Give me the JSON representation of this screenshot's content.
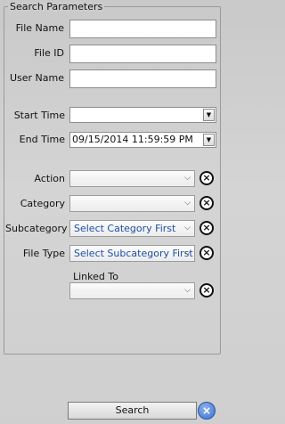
{
  "panel": {
    "title": "Search Parameters"
  },
  "fields": {
    "file_name": {
      "label": "File Name",
      "value": ""
    },
    "file_id": {
      "label": "File ID",
      "value": ""
    },
    "user_name": {
      "label": "User Name",
      "value": ""
    },
    "start_time": {
      "label": "Start Time",
      "value": ""
    },
    "end_time": {
      "label": "End Time",
      "value": "09/15/2014 11:59:59 PM"
    },
    "action": {
      "label": "Action",
      "value": ""
    },
    "category": {
      "label": "Category",
      "value": ""
    },
    "subcategory": {
      "label": "Subcategory",
      "value": "Select Category First"
    },
    "file_type": {
      "label": "File Type",
      "value": "Select Subcategory First"
    },
    "linked_to": {
      "label": "Linked To",
      "value": ""
    }
  },
  "search_button": {
    "label": "Search"
  },
  "colors": {
    "placeholder_text": "#1f4fa8",
    "search_clear_icon": "#3a6fd0"
  }
}
